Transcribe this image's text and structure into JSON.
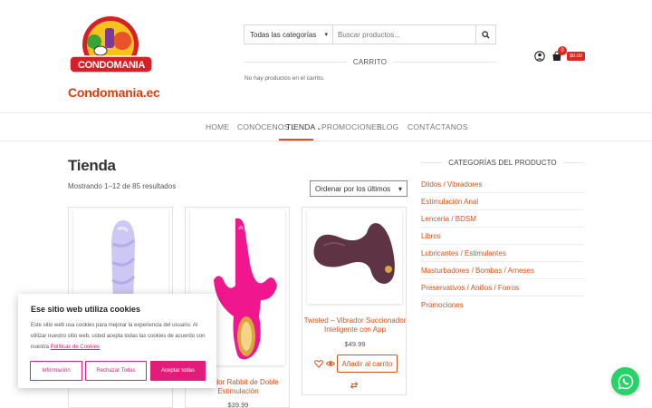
{
  "brand": {
    "logo_text": "CONDOMANIA",
    "site_name": "Condomania.ec",
    "accent": "#d3541c",
    "logo_red": "#d61f26",
    "logo_yellow": "#f8c21c"
  },
  "search": {
    "category": "Todas las categorías",
    "placeholder": "Buscar productos...",
    "icon": "search-icon"
  },
  "mini_cart": {
    "title": "CARRITO",
    "empty_text": "No hay productos en el carrito.",
    "count": "0",
    "total": "$0.00"
  },
  "nav": {
    "items": [
      {
        "label": "HOME"
      },
      {
        "label": "CONÓCENOS"
      },
      {
        "label": "TIENDA"
      },
      {
        "label": "PROMOCIONES"
      },
      {
        "label": "BLOG"
      },
      {
        "label": "CONTÁCTANOS"
      }
    ],
    "active": "TIENDA"
  },
  "shop": {
    "title": "Tienda",
    "results": "Mostrando 1–12 de 85 resultados",
    "orderby": "Ordenar por los últimos"
  },
  "products": [
    {
      "name": "",
      "price": "",
      "color": "#c9c3f0"
    },
    {
      "name_line1": "Vibrador Rabbit de Doble",
      "name_line2": "Estimulación",
      "price": "$39.99",
      "color": "#f0168e"
    },
    {
      "name_line1": "Twisted – Vibrador Succionador",
      "name_line2": "Inteligente con App",
      "price": "$49.99",
      "add_label": "Añadir al carrito",
      "color": "#5e3343"
    }
  ],
  "sidebar": {
    "title": "CATEGORÍAS DEL PRODUCTO",
    "categories": [
      "Dildos / Vibradores",
      "Estimulación Anal",
      "Lencería / BDSM",
      "Libros",
      "Lubricantes / Estimulantes",
      "Masturbadores / Bombas / Arneses",
      "Preservativos / Anillos / Forros",
      "Promociones"
    ]
  },
  "cookie": {
    "title": "Ese sitio web utiliza cookies",
    "text": "Este sitio web usa cookies para mejorar la experiencia del usuario. Al utilizar nuestro sitio web, usted acepta todas las cookies de acuerdo con nuestra",
    "link": "Políticas de Cookies",
    "buttons": {
      "info": "Información",
      "reject": "Rechazar Todas",
      "accept": "Aceptar todas"
    },
    "accent": "#e31c79"
  },
  "whatsapp": {
    "color": "#25d366",
    "icon": "whatsapp-icon"
  }
}
